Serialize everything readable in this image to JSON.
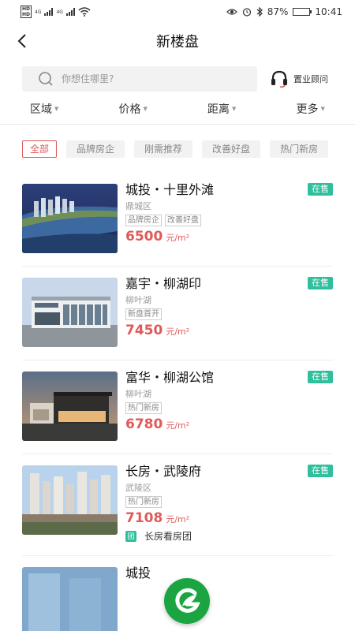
{
  "status_bar": {
    "net_left": "4G",
    "net_right": "4G",
    "battery": "87%",
    "time": "10:41",
    "battery_level": 0.87
  },
  "nav": {
    "title": "新楼盘",
    "back_icon": "chevron-left-icon"
  },
  "search": {
    "placeholder": "你想住哪里?",
    "advisor_label": "置业顾问"
  },
  "filters": [
    "区域",
    "价格",
    "距离",
    "更多"
  ],
  "tags": [
    "全部",
    "品牌房企",
    "刚需推荐",
    "改善好盘",
    "热门新房"
  ],
  "active_tag": "全部",
  "unit": "元/m²",
  "listings": [
    {
      "name": "城投・十里外滩",
      "district": "鼎城区",
      "labels": [
        "品牌房企",
        "改善好盘"
      ],
      "price": "6500",
      "status": "在售"
    },
    {
      "name": "嘉宇・柳湖印",
      "district": "柳叶湖",
      "labels": [
        "新盘首开"
      ],
      "price": "7450",
      "status": "在售"
    },
    {
      "name": "富华・柳湖公馆",
      "district": "柳叶湖",
      "labels": [
        "热门新房"
      ],
      "price": "6780",
      "status": "在售"
    },
    {
      "name": "长房・武陵府",
      "district": "武陵区",
      "labels": [
        "热门新房"
      ],
      "price": "7108",
      "status": "在售",
      "group_icon": "团",
      "group_text": "长房看房团"
    },
    {
      "name": "城投"
    }
  ],
  "colors": {
    "accent_red": "#e05a5a",
    "status_green": "#2fbf9c",
    "fab_green": "#1aa542"
  }
}
